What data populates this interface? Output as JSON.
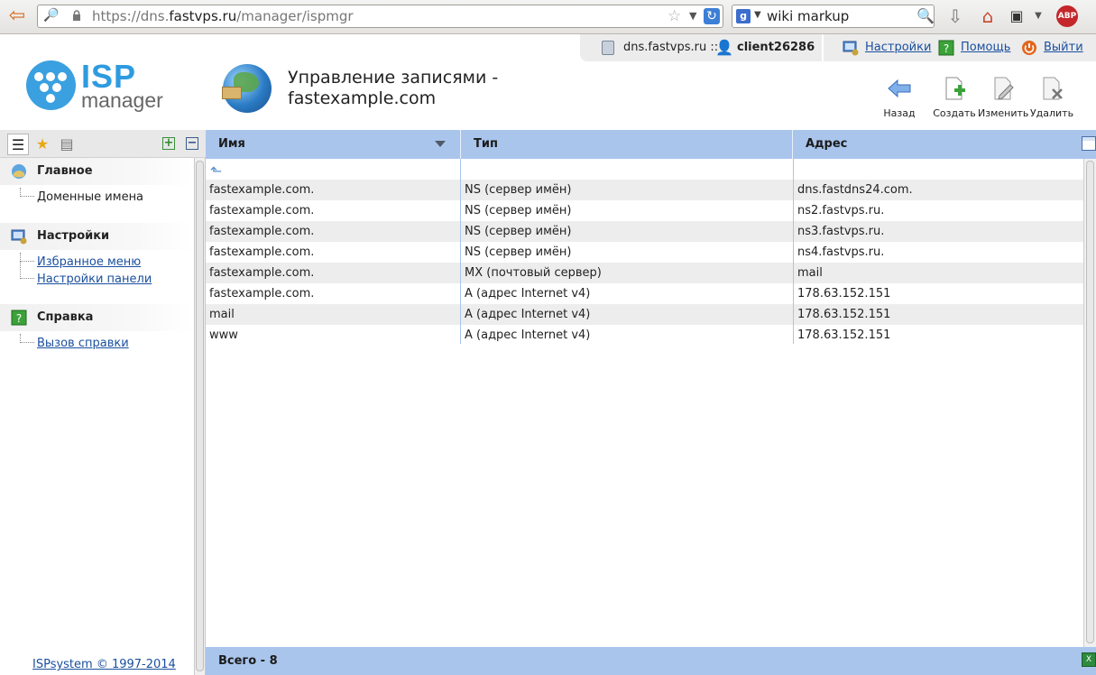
{
  "browser": {
    "url_prefix": "https://dns.",
    "url_domain": "fastvps.ru",
    "url_path": "/manager/ispmgr",
    "search_value": "wiki markup",
    "adblock_label": "ABP"
  },
  "session": {
    "server": "dns.fastvps.ru ::",
    "user": "client26286"
  },
  "top_links": {
    "settings": "Настройки",
    "help": "Помощь",
    "logout": "Выйти"
  },
  "logo": {
    "line1": "ISP",
    "line2": "manager"
  },
  "page": {
    "title_line1": "Управление записями -",
    "title_line2": "fastexample.com"
  },
  "actions": {
    "back": "Назад",
    "create": "Создать",
    "edit": "Изменить",
    "delete": "Удалить"
  },
  "sidebar": {
    "sections": [
      {
        "label": "Главное",
        "items": [
          "Доменные имена"
        ]
      },
      {
        "label": "Настройки",
        "items": [
          "Избранное меню",
          "Настройки панели"
        ]
      },
      {
        "label": "Справка",
        "items": [
          "Вызов справки"
        ]
      }
    ],
    "footer": "ISPsystem © 1997-2014"
  },
  "table": {
    "columns": [
      "Имя",
      "Тип",
      "Адрес"
    ],
    "rows": [
      [
        "fastexample.com.",
        "NS (сервер имён)",
        "dns.fastdns24.com."
      ],
      [
        "fastexample.com.",
        "NS (сервер имён)",
        "ns2.fastvps.ru."
      ],
      [
        "fastexample.com.",
        "NS (сервер имён)",
        "ns3.fastvps.ru."
      ],
      [
        "fastexample.com.",
        "NS (сервер имён)",
        "ns4.fastvps.ru."
      ],
      [
        "fastexample.com.",
        "MX (почтовый сервер)",
        "mail"
      ],
      [
        "fastexample.com.",
        "A (адрес Internet v4)",
        "178.63.152.151"
      ],
      [
        "mail",
        "A (адрес Internet v4)",
        "178.63.152.151"
      ],
      [
        "www",
        "A (адрес Internet v4)",
        "178.63.152.151"
      ]
    ],
    "total": "Всего - 8"
  }
}
